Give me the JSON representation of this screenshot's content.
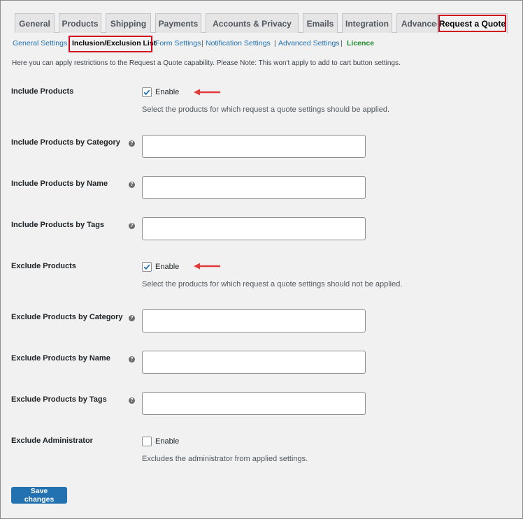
{
  "tabs": [
    {
      "label": "General"
    },
    {
      "label": "Products"
    },
    {
      "label": "Shipping"
    },
    {
      "label": "Payments"
    },
    {
      "label": "Accounts & Privacy"
    },
    {
      "label": "Emails"
    },
    {
      "label": "Integration"
    },
    {
      "label": "Advanced"
    },
    {
      "label": "Request a Quote",
      "active": true,
      "highlighted": true
    }
  ],
  "subnav": {
    "items": [
      {
        "label": "General Settings"
      },
      {
        "label": "Inclusion/Exclusion List",
        "current": true,
        "highlighted": true
      },
      {
        "label": "Form Settings"
      },
      {
        "label": "Notification Settings"
      },
      {
        "label": "Advanced Settings"
      },
      {
        "label": "Licence"
      }
    ],
    "separator": "|"
  },
  "intro_text": "Here you can apply restrictions to the Request a Quote capability. Please Note: This won't apply to add to cart button settings.",
  "help_glyph": "?",
  "settings": {
    "include_products": {
      "label": "Include Products",
      "checkbox_label": "Enable",
      "checked": true,
      "description": "Select the products for which request a quote settings should be applied."
    },
    "include_by_category": {
      "label": "Include Products by Category",
      "value": ""
    },
    "include_by_name": {
      "label": "Include Products by Name",
      "value": ""
    },
    "include_by_tags": {
      "label": "Include Products by Tags",
      "value": ""
    },
    "exclude_products": {
      "label": "Exclude Products",
      "checkbox_label": "Enable",
      "checked": true,
      "description": "Select the products for which request a quote settings should not be applied."
    },
    "exclude_by_category": {
      "label": "Exclude Products by Category",
      "value": ""
    },
    "exclude_by_name": {
      "label": "Exclude Products by Name",
      "value": ""
    },
    "exclude_by_tags": {
      "label": "Exclude Products by Tags",
      "value": ""
    },
    "exclude_administrator": {
      "label": "Exclude Administrator",
      "checkbox_label": "Enable",
      "checked": false,
      "description": "Excludes the administrator from applied settings."
    }
  },
  "save_button": "Save changes",
  "colors": {
    "link": "#2271b1",
    "button": "#2271b1",
    "highlight": "#d0021b",
    "arrow": "#e03a3a",
    "licence": "#1e8c2e",
    "checkmark": "#2271b1"
  },
  "icons": {
    "help": "help-icon",
    "checkmark": "checkmark-icon",
    "annotation_arrow": "arrow-left-icon"
  }
}
